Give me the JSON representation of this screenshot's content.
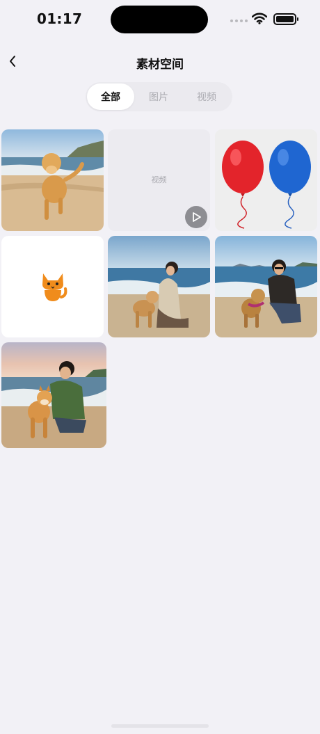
{
  "status_bar": {
    "time": "01:17"
  },
  "nav": {
    "title": "素材空间"
  },
  "tabs": [
    {
      "label": "全部",
      "active": true
    },
    {
      "label": "图片",
      "active": false
    },
    {
      "label": "视频",
      "active": false
    }
  ],
  "media": {
    "items": [
      {
        "kind": "image",
        "subject": "golden retriever running on beach"
      },
      {
        "kind": "video",
        "label": "视频"
      },
      {
        "kind": "image",
        "subject": "red and blue balloons"
      },
      {
        "kind": "image",
        "subject": "cat emoji"
      },
      {
        "kind": "image",
        "subject": "woman with dog on beach"
      },
      {
        "kind": "image",
        "subject": "man with dog on beach"
      },
      {
        "kind": "image",
        "subject": "woman with shiba inu on beach at sunset"
      }
    ]
  },
  "colors": {
    "background": "#f2f1f6",
    "active_tab": "#ffffff",
    "inactive_tab_text": "#aaaab0",
    "balloon_red": "#e3242b",
    "balloon_blue": "#1f66d1"
  }
}
